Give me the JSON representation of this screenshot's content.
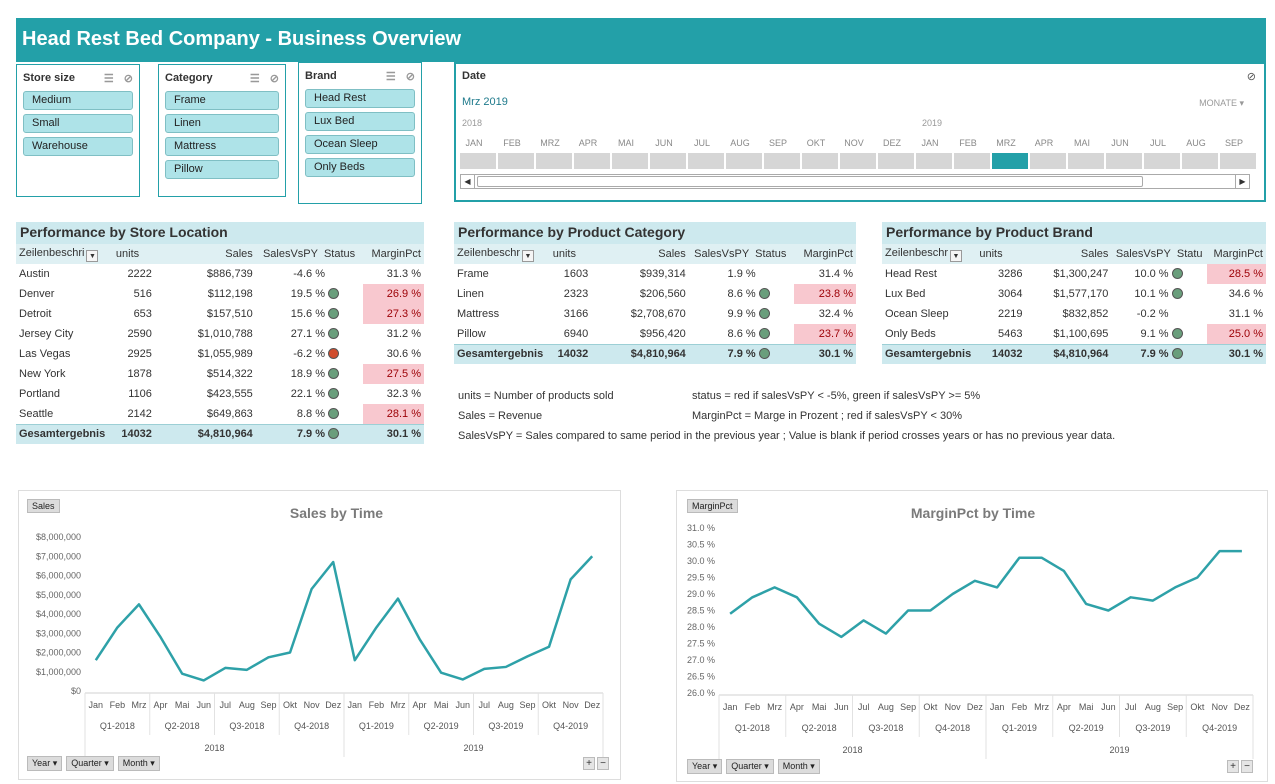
{
  "header": {
    "title": "Head Rest Bed Company - Business Overview"
  },
  "slicers": {
    "store_size": {
      "title": "Store size",
      "items": [
        "Medium",
        "Small",
        "Warehouse"
      ]
    },
    "category": {
      "title": "Category",
      "items": [
        "Frame",
        "Linen",
        "Mattress",
        "Pillow"
      ]
    },
    "brand": {
      "title": "Brand",
      "items": [
        "Head Rest",
        "Lux Bed",
        "Ocean Sleep",
        "Only Beds"
      ]
    }
  },
  "timeline": {
    "title": "Date",
    "selection": "Mrz 2019",
    "level": "MONATE",
    "years": [
      "2018",
      "2019"
    ],
    "months": [
      "JAN",
      "FEB",
      "MRZ",
      "APR",
      "MAI",
      "JUN",
      "JUL",
      "AUG",
      "SEP",
      "OKT",
      "NOV",
      "DEZ",
      "JAN",
      "FEB",
      "MRZ",
      "APR",
      "MAI",
      "JUN",
      "JUL",
      "AUG",
      "SEP"
    ],
    "selected_index": 14
  },
  "store_table": {
    "title": "Performance by Store Location",
    "headers": [
      "Zeilenbeschri",
      "units",
      "Sales",
      "SalesVsPY",
      "Status",
      "MarginPct"
    ],
    "rows": [
      {
        "name": "Austin",
        "units": "2222",
        "sales": "$886,739",
        "vspy": "-4.6 %",
        "status": "",
        "margin": "31.3 %",
        "red": false
      },
      {
        "name": "Denver",
        "units": "516",
        "sales": "$112,198",
        "vspy": "19.5 %",
        "status": "green",
        "margin": "26.9 %",
        "red": true
      },
      {
        "name": "Detroit",
        "units": "653",
        "sales": "$157,510",
        "vspy": "15.6 %",
        "status": "green",
        "margin": "27.3 %",
        "red": true
      },
      {
        "name": "Jersey City",
        "units": "2590",
        "sales": "$1,010,788",
        "vspy": "27.1 %",
        "status": "green",
        "margin": "31.2 %",
        "red": false
      },
      {
        "name": "Las Vegas",
        "units": "2925",
        "sales": "$1,055,989",
        "vspy": "-6.2 %",
        "status": "red",
        "margin": "30.6 %",
        "red": false
      },
      {
        "name": "New York",
        "units": "1878",
        "sales": "$514,322",
        "vspy": "18.9 %",
        "status": "green",
        "margin": "27.5 %",
        "red": true
      },
      {
        "name": "Portland",
        "units": "1106",
        "sales": "$423,555",
        "vspy": "22.1 %",
        "status": "green",
        "margin": "32.3 %",
        "red": false
      },
      {
        "name": "Seattle",
        "units": "2142",
        "sales": "$649,863",
        "vspy": "8.8 %",
        "status": "green",
        "margin": "28.1 %",
        "red": true
      }
    ],
    "total": {
      "name": "Gesamtergebnis",
      "units": "14032",
      "sales": "$4,810,964",
      "vspy": "7.9 %",
      "status": "green",
      "margin": "30.1 %"
    }
  },
  "category_table": {
    "title": "Performance  by Product Category",
    "headers": [
      "Zeilenbeschr",
      "units",
      "Sales",
      "SalesVsPY",
      "Status",
      "MarginPct"
    ],
    "rows": [
      {
        "name": "Frame",
        "units": "1603",
        "sales": "$939,314",
        "vspy": "1.9 %",
        "status": "",
        "margin": "31.4 %",
        "red": false
      },
      {
        "name": "Linen",
        "units": "2323",
        "sales": "$206,560",
        "vspy": "8.6 %",
        "status": "green",
        "margin": "23.8 %",
        "red": true
      },
      {
        "name": "Mattress",
        "units": "3166",
        "sales": "$2,708,670",
        "vspy": "9.9 %",
        "status": "green",
        "margin": "32.4 %",
        "red": false
      },
      {
        "name": "Pillow",
        "units": "6940",
        "sales": "$956,420",
        "vspy": "8.6 %",
        "status": "green",
        "margin": "23.7 %",
        "red": true
      }
    ],
    "total": {
      "name": "Gesamtergebnis",
      "units": "14032",
      "sales": "$4,810,964",
      "vspy": "7.9 %",
      "status": "green",
      "margin": "30.1 %"
    }
  },
  "brand_table": {
    "title": "Performance by Product Brand",
    "headers": [
      "Zeilenbeschr",
      "units",
      "Sales",
      "SalesVsPY",
      "Statu",
      "MarginPct"
    ],
    "rows": [
      {
        "name": "Head Rest",
        "units": "3286",
        "sales": "$1,300,247",
        "vspy": "10.0 %",
        "status": "green",
        "margin": "28.5 %",
        "red": true
      },
      {
        "name": "Lux Bed",
        "units": "3064",
        "sales": "$1,577,170",
        "vspy": "10.1 %",
        "status": "green",
        "margin": "34.6 %",
        "red": false
      },
      {
        "name": "Ocean Sleep",
        "units": "2219",
        "sales": "$832,852",
        "vspy": "-0.2 %",
        "status": "",
        "margin": "31.1 %",
        "red": false
      },
      {
        "name": "Only Beds",
        "units": "5463",
        "sales": "$1,100,695",
        "vspy": "9.1 %",
        "status": "green",
        "margin": "25.0 %",
        "red": true
      }
    ],
    "total": {
      "name": "Gesamtergebnis",
      "units": "14032",
      "sales": "$4,810,964",
      "vspy": "7.9 %",
      "status": "green",
      "margin": "30.1 %"
    }
  },
  "notes": {
    "units": "units = Number of products sold",
    "sales": "Sales = Revenue",
    "status": "status = red if salesVsPY < -5%, green if salesVsPY >= 5%",
    "margin": "MarginPct = Marge in Prozent ; red if salesVsPY < 30%",
    "vspy": "SalesVsPY = Sales compared to same period in the previous year ; Value is blank if period crosses years or has no previous year data."
  },
  "chart_common": {
    "months": [
      "Jan",
      "Feb",
      "Mrz",
      "Apr",
      "Mai",
      "Jun",
      "Jul",
      "Aug",
      "Sep",
      "Okt",
      "Nov",
      "Dez",
      "Jan",
      "Feb",
      "Mrz",
      "Apr",
      "Mai",
      "Jun",
      "Jul",
      "Aug",
      "Sep",
      "Okt",
      "Nov",
      "Dez"
    ],
    "quarters": [
      "Q1-2018",
      "Q2-2018",
      "Q3-2018",
      "Q4-2018",
      "Q1-2019",
      "Q2-2019",
      "Q3-2019",
      "Q4-2019"
    ],
    "years": [
      "2018",
      "2019"
    ],
    "buttons": [
      "Year",
      "Quarter",
      "Month"
    ],
    "line_color": "#2ea1a8"
  },
  "chart_data": [
    {
      "type": "line",
      "title": "Sales by Time",
      "field_label": "Sales",
      "x": [
        "Jan 2018",
        "Feb 2018",
        "Mrz 2018",
        "Apr 2018",
        "Mai 2018",
        "Jun 2018",
        "Jul 2018",
        "Aug 2018",
        "Sep 2018",
        "Okt 2018",
        "Nov 2018",
        "Dez 2018",
        "Jan 2019",
        "Feb 2019",
        "Mrz 2019",
        "Apr 2019",
        "Mai 2019",
        "Jun 2019",
        "Jul 2019",
        "Aug 2019",
        "Sep 2019",
        "Okt 2019",
        "Nov 2019",
        "Dez 2019"
      ],
      "values": [
        1600000,
        3300000,
        4500000,
        2800000,
        900000,
        550000,
        1200000,
        1100000,
        1750000,
        2000000,
        5300000,
        6700000,
        1600000,
        3300000,
        4800000,
        2700000,
        950000,
        600000,
        1150000,
        1250000,
        1800000,
        2300000,
        5800000,
        7000000
      ],
      "ylim": [
        0,
        8000000
      ],
      "yticks": [
        "$0",
        "$1,000,000",
        "$2,000,000",
        "$3,000,000",
        "$4,000,000",
        "$5,000,000",
        "$6,000,000",
        "$7,000,000",
        "$8,000,000"
      ]
    },
    {
      "type": "line",
      "title": "MarginPct by Time",
      "field_label": "MarginPct",
      "x": [
        "Jan 2018",
        "Feb 2018",
        "Mrz 2018",
        "Apr 2018",
        "Mai 2018",
        "Jun 2018",
        "Jul 2018",
        "Aug 2018",
        "Sep 2018",
        "Okt 2018",
        "Nov 2018",
        "Dez 2018",
        "Jan 2019",
        "Feb 2019",
        "Mrz 2019",
        "Apr 2019",
        "Mai 2019",
        "Jun 2019",
        "Jul 2019",
        "Aug 2019",
        "Sep 2019",
        "Okt 2019",
        "Nov 2019",
        "Dez 2019"
      ],
      "values": [
        28.4,
        28.9,
        29.2,
        28.9,
        28.1,
        27.7,
        28.2,
        27.8,
        28.5,
        28.5,
        29.0,
        29.4,
        29.2,
        30.1,
        30.1,
        29.7,
        28.7,
        28.5,
        28.9,
        28.8,
        29.2,
        29.5,
        30.3,
        30.3
      ],
      "ylim": [
        26.0,
        31.0
      ],
      "yticks": [
        "26.0 %",
        "26.5 %",
        "27.0 %",
        "27.5 %",
        "28.0 %",
        "28.5 %",
        "29.0 %",
        "29.5 %",
        "30.0 %",
        "30.5 %",
        "31.0 %"
      ]
    }
  ]
}
